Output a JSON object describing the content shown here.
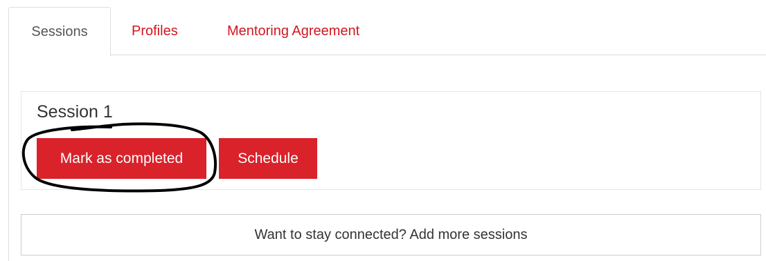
{
  "tabs": [
    {
      "label": "Sessions",
      "active": true
    },
    {
      "label": "Profiles",
      "active": false
    },
    {
      "label": "Mentoring Agreement",
      "active": false
    }
  ],
  "session": {
    "title": "Session 1",
    "complete_label": "Mark as completed",
    "schedule_label": "Schedule"
  },
  "add_sessions_label": "Want to stay connected? Add more sessions",
  "colors": {
    "accent": "#d9222a",
    "link": "#d0171f",
    "border": "#dddddd",
    "annotation": "#000000"
  }
}
